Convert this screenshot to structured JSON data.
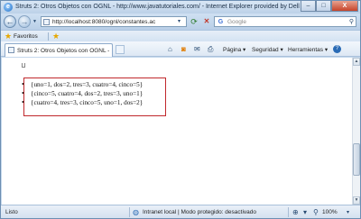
{
  "window": {
    "title": "Struts 2: Otros Objetos con OGNL - http://www.javatutoriales.com/ - Internet Explorer provided by Dell",
    "minimize": "–",
    "maximize": "□",
    "close": "X"
  },
  "address": {
    "url": "http://localhost:8080/ognl/constantes.ac",
    "go": "▾"
  },
  "search": {
    "placeholder": "Google",
    "engine_letter": "G",
    "button": "⚲"
  },
  "favorites": {
    "label": "Favoritos"
  },
  "tab": {
    "title": "Struts 2: Otros Objetos con OGNL - h..."
  },
  "command_bar": {
    "page_label": "Página",
    "safety_label": "Seguridad",
    "tools_label": "Herramientas",
    "help_icon": "?"
  },
  "content": {
    "items": [
      "{uno=1, dos=2, tres=3, cuatro=4, cinco=5}",
      "{cinco=5, cuatro=4, dos=2, tres=3, uno=1}",
      "{cuatro=4, tres=3, cinco=5, uno=1, dos=2}"
    ],
    "highlight_color": "#c0282c"
  },
  "status": {
    "text": "Listo",
    "zone": "Intranet local | Modo protegido: desactivado",
    "zoom": "100%"
  },
  "icons": {
    "back": "back-arrow-icon",
    "forward": "forward-arrow-icon",
    "refresh": "refresh-icon",
    "stop": "stop-icon",
    "home": "home-icon",
    "feeds": "rss-feed-icon",
    "mail": "mail-icon",
    "print": "printer-icon"
  }
}
